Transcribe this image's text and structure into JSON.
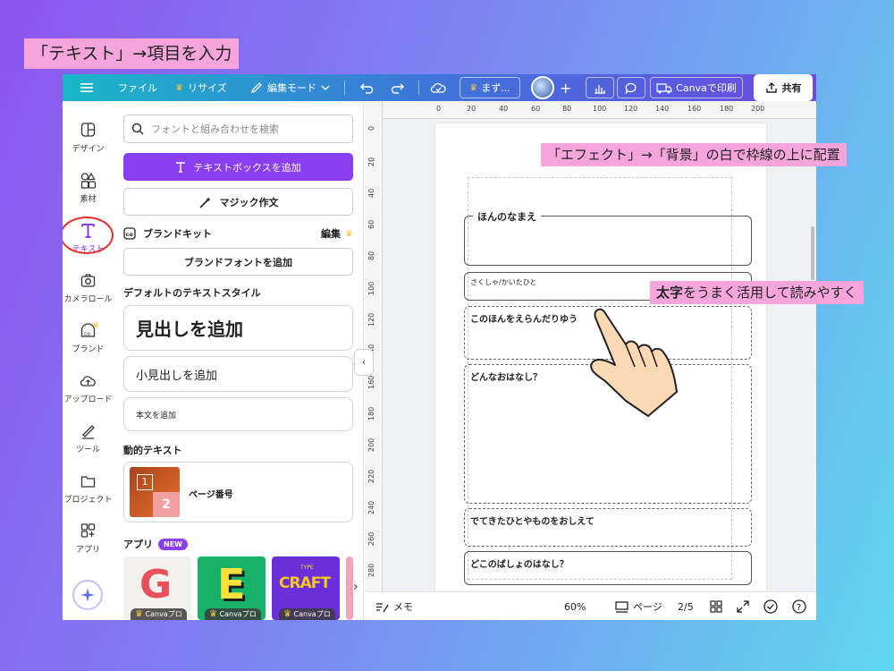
{
  "tutorial_label": "「テキスト」→項目を入力",
  "topbar": {
    "file": "ファイル",
    "resize": "リサイズ",
    "edit_mode": "編集モード",
    "draft": "まず...",
    "print": "Canvaで印刷",
    "share": "共有"
  },
  "rail": {
    "items": [
      {
        "label": "デザイン",
        "icon": "layout-icon"
      },
      {
        "label": "素材",
        "icon": "elements-icon"
      },
      {
        "label": "テキスト",
        "icon": "text-icon"
      },
      {
        "label": "カメラロール",
        "icon": "camera-icon"
      },
      {
        "label": "ブランド",
        "icon": "brand-icon"
      },
      {
        "label": "アップロード",
        "icon": "upload-icon"
      },
      {
        "label": "ツール",
        "icon": "tools-icon"
      },
      {
        "label": "プロジェクト",
        "icon": "folder-icon"
      },
      {
        "label": "アプリ",
        "icon": "apps-icon"
      }
    ]
  },
  "panel": {
    "search_placeholder": "フォントと組み合わせを検索",
    "add_textbox": "テキストボックスを追加",
    "magic_write": "マジック作文",
    "brand_kit": "ブランドキット",
    "brand_edit": "編集",
    "add_brand_font": "ブランドフォントを追加",
    "default_styles_title": "デフォルトのテキストスタイル",
    "heading": "見出しを追加",
    "subheading": "小見出しを追加",
    "body": "本文を追加",
    "dynamic_title": "動的テキスト",
    "page_number": "ページ番号",
    "thumb_num1": "1",
    "thumb_num2": "2",
    "apps_title": "アプリ",
    "new_badge": "NEW",
    "app_tag": "Canvaプロ",
    "app_letters": [
      "G",
      "E",
      "CRAFT"
    ],
    "craft_small": "TYPE"
  },
  "ruler": {
    "top": [
      "0",
      "20",
      "40",
      "60",
      "80",
      "100",
      "120",
      "140",
      "160",
      "180",
      "200"
    ],
    "left": [
      "0",
      "20",
      "40",
      "60",
      "80",
      "100",
      "120",
      "140",
      "160",
      "180",
      "200",
      "220",
      "240",
      "260",
      "280"
    ]
  },
  "worksheet": {
    "name": "ほんのなまえ",
    "author": "さくしゃ/かいたひと",
    "reason": "このほんをえらんだりゆう",
    "story": "どんなおはなし？",
    "characters": "でてきたひとやものをおしえて",
    "place": "どこのばしょのはなし？"
  },
  "bottombar": {
    "memo": "メモ",
    "zoom": "60%",
    "pages": "ページ",
    "page_count": "2/5"
  },
  "annotations": {
    "effect": "「エフェクト」→「背景」の白で枠線の上に配置",
    "bold_prefix": "太字",
    "bold_rest": "をうまく活用して読みやすく"
  },
  "colors": {
    "accent": "#8b3df0",
    "highlight": "#f6a5dc",
    "circle": "#e0302b"
  }
}
